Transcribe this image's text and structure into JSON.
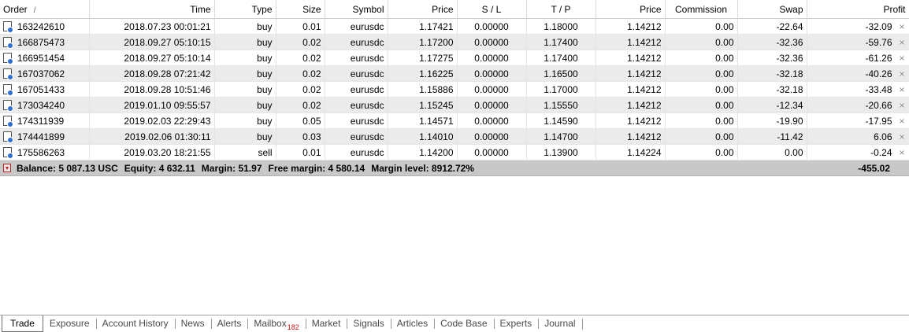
{
  "columns": {
    "order": "Order",
    "sort_indicator": "/",
    "time": "Time",
    "type": "Type",
    "size": "Size",
    "symbol": "Symbol",
    "price": "Price",
    "sl": "S / L",
    "tp": "T / P",
    "price2": "Price",
    "commission": "Commission",
    "swap": "Swap",
    "profit": "Profit"
  },
  "rows": [
    {
      "order": "163242610",
      "time": "2018.07.23 00:01:21",
      "type": "buy",
      "size": "0.01",
      "symbol": "eurusdc",
      "price": "1.17421",
      "sl": "0.00000",
      "tp": "1.18000",
      "price2": "1.14212",
      "commission": "0.00",
      "swap": "-22.64",
      "profit": "-32.09"
    },
    {
      "order": "166875473",
      "time": "2018.09.27 05:10:15",
      "type": "buy",
      "size": "0.02",
      "symbol": "eurusdc",
      "price": "1.17200",
      "sl": "0.00000",
      "tp": "1.17400",
      "price2": "1.14212",
      "commission": "0.00",
      "swap": "-32.36",
      "profit": "-59.76"
    },
    {
      "order": "166951454",
      "time": "2018.09.27 05:10:14",
      "type": "buy",
      "size": "0.02",
      "symbol": "eurusdc",
      "price": "1.17275",
      "sl": "0.00000",
      "tp": "1.17400",
      "price2": "1.14212",
      "commission": "0.00",
      "swap": "-32.36",
      "profit": "-61.26"
    },
    {
      "order": "167037062",
      "time": "2018.09.28 07:21:42",
      "type": "buy",
      "size": "0.02",
      "symbol": "eurusdc",
      "price": "1.16225",
      "sl": "0.00000",
      "tp": "1.16500",
      "price2": "1.14212",
      "commission": "0.00",
      "swap": "-32.18",
      "profit": "-40.26"
    },
    {
      "order": "167051433",
      "time": "2018.09.28 10:51:46",
      "type": "buy",
      "size": "0.02",
      "symbol": "eurusdc",
      "price": "1.15886",
      "sl": "0.00000",
      "tp": "1.17000",
      "price2": "1.14212",
      "commission": "0.00",
      "swap": "-32.18",
      "profit": "-33.48"
    },
    {
      "order": "173034240",
      "time": "2019.01.10 09:55:57",
      "type": "buy",
      "size": "0.02",
      "symbol": "eurusdc",
      "price": "1.15245",
      "sl": "0.00000",
      "tp": "1.15550",
      "price2": "1.14212",
      "commission": "0.00",
      "swap": "-12.34",
      "profit": "-20.66"
    },
    {
      "order": "174311939",
      "time": "2019.02.03 22:29:43",
      "type": "buy",
      "size": "0.05",
      "symbol": "eurusdc",
      "price": "1.14571",
      "sl": "0.00000",
      "tp": "1.14590",
      "price2": "1.14212",
      "commission": "0.00",
      "swap": "-19.90",
      "profit": "-17.95"
    },
    {
      "order": "174441899",
      "time": "2019.02.06 01:30:11",
      "type": "buy",
      "size": "0.03",
      "symbol": "eurusdc",
      "price": "1.14010",
      "sl": "0.00000",
      "tp": "1.14700",
      "price2": "1.14212",
      "commission": "0.00",
      "swap": "-11.42",
      "profit": "6.06"
    },
    {
      "order": "175586263",
      "time": "2019.03.20 18:21:55",
      "type": "sell",
      "size": "0.01",
      "symbol": "eurusdc",
      "price": "1.14200",
      "sl": "0.00000",
      "tp": "1.13900",
      "price2": "1.14224",
      "commission": "0.00",
      "swap": "0.00",
      "profit": "-0.24"
    }
  ],
  "row_close_glyph": "×",
  "summary": {
    "balance": "Balance: 5 087.13 USC",
    "equity": "Equity: 4 632.11",
    "margin": "Margin: 51.97",
    "free_margin": "Free margin: 4 580.14",
    "margin_level": "Margin level: 8912.72%",
    "total_profit": "-455.02"
  },
  "tabs": [
    {
      "label": "Trade",
      "active": true
    },
    {
      "label": "Exposure"
    },
    {
      "label": "Account History"
    },
    {
      "label": "News"
    },
    {
      "label": "Alerts"
    },
    {
      "label": "Mailbox",
      "badge": "182"
    },
    {
      "label": "Market"
    },
    {
      "label": "Signals"
    },
    {
      "label": "Articles"
    },
    {
      "label": "Code Base"
    },
    {
      "label": "Experts"
    },
    {
      "label": "Journal"
    }
  ],
  "icons": {
    "row": "order-document-icon",
    "summary": "balance-icon",
    "close": "close-icon"
  },
  "colors": {
    "summary_bg": "#c8c8c8",
    "badge": "#d01010",
    "row_alt": "#ebebeb"
  }
}
